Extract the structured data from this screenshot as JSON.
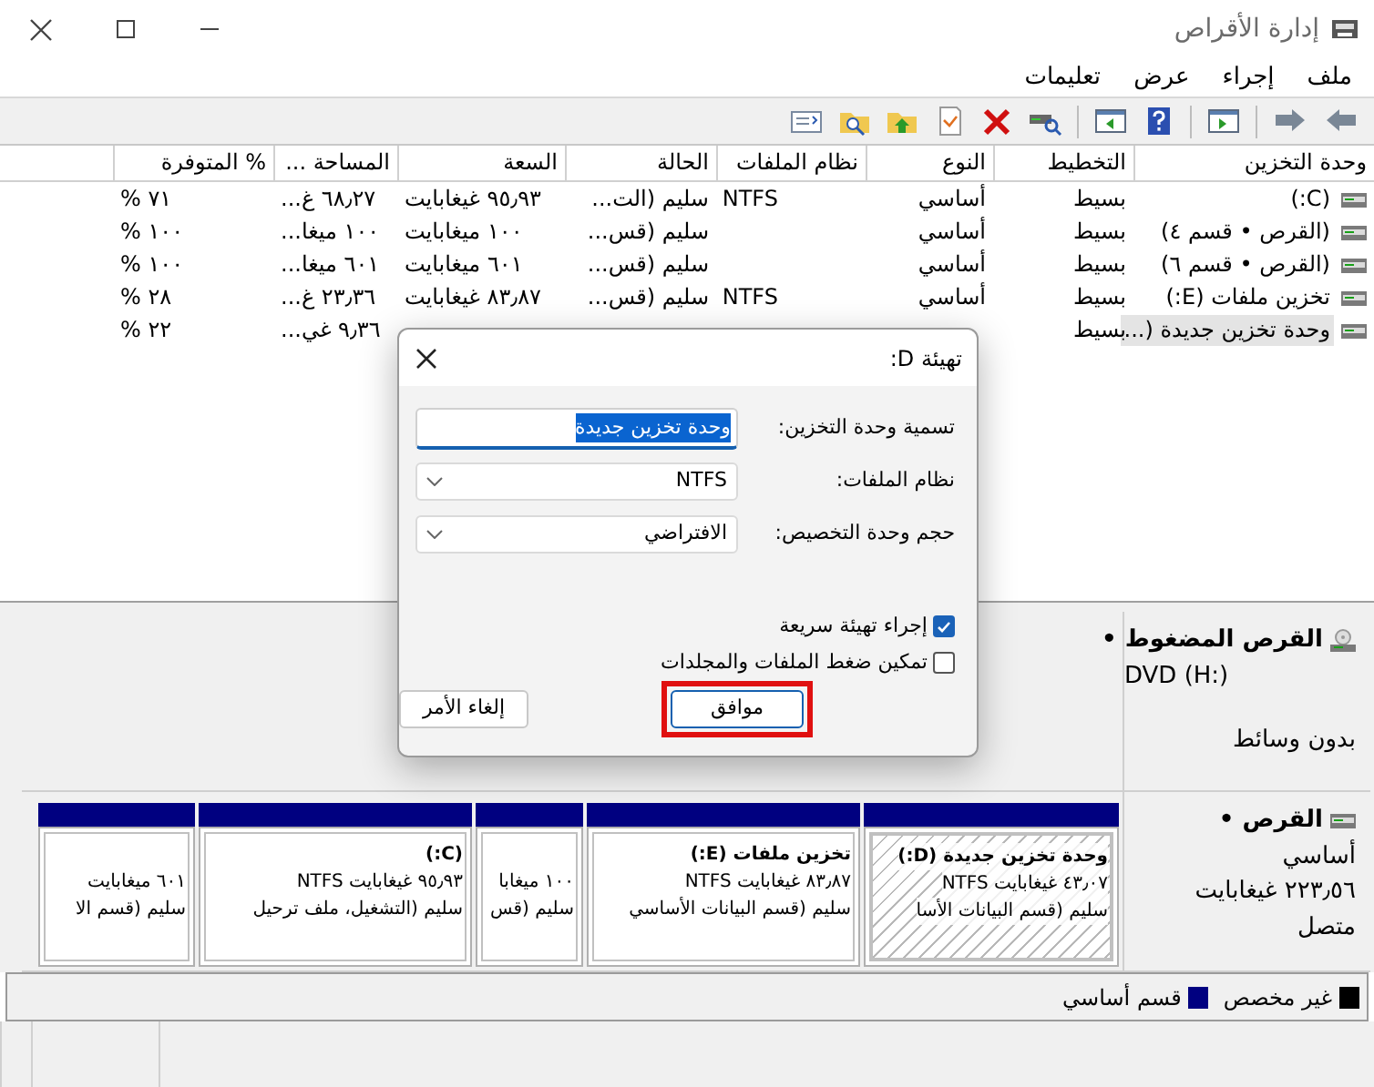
{
  "window": {
    "title": "إدارة الأقراص"
  },
  "menu": [
    "ملف",
    "إجراء",
    "عرض",
    "تعليمات"
  ],
  "volumes": {
    "columns": [
      "وحدة التخزين",
      "التخطيط",
      "النوع",
      "نظام الملفات",
      "الحالة",
      "السعة",
      "المساحة ...",
      "% المتوفرة"
    ],
    "rows": [
      {
        "cells": [
          "(C:)",
          "بسيط",
          "أساسي",
          "NTFS",
          "سليم (الت...",
          "٩٥٫٩٣ غيغابايت",
          "٦٨٫٢٧ غ...",
          "٧١ %"
        ],
        "selected": false
      },
      {
        "cells": [
          "(القرص • قسم ٤)",
          "بسيط",
          "أساسي",
          null,
          "سليم (قس...",
          "١٠٠ ميغابايت",
          "١٠٠ ميغا...",
          "١٠٠ %"
        ],
        "selected": false
      },
      {
        "cells": [
          "(القرص • قسم ٦)",
          "بسيط",
          "أساسي",
          null,
          "سليم (قس...",
          "٦٠١ ميغابايت",
          "٦٠١ ميغا...",
          "١٠٠ %"
        ],
        "selected": false
      },
      {
        "cells": [
          "تخزين ملفات (E:)",
          "بسيط",
          "أساسي",
          "NTFS",
          "سليم (قس...",
          "٨٣٫٨٧ غيغابايت",
          "٢٣٫٣٦ غ...",
          "٢٨ %"
        ],
        "selected": false
      },
      {
        "cells": [
          "وحدة تخزين جديدة (...",
          "بسيط",
          null,
          null,
          null,
          null,
          "٩٫٣٦ غي...",
          "٢٢ %"
        ],
        "selected": true
      }
    ]
  },
  "disks": [
    {
      "kind": "cdrom",
      "name": "القرص المضغوط •",
      "lines": [
        "DVD (H:)",
        "بدون وسائط"
      ]
    },
    {
      "kind": "disk",
      "name": "القرص •",
      "lines": [
        "أساسي",
        "٢٢٣٫٥٦ غيغابايت",
        "متصل"
      ],
      "partitions": [
        {
          "title": "وحدة تخزين جديدة (D:)",
          "size": "٤٣٫٠٧ غيغابايت NTFS",
          "status": "سليم (قسم البيانات الأسا",
          "selected": true
        },
        {
          "title": "تخزين ملفات (E:)",
          "size": "٨٣٫٨٧ غيغابايت NTFS",
          "status": "سليم (قسم البيانات الأساسي",
          "selected": false
        },
        {
          "size": "١٠٠ ميغابا",
          "status": "سليم (قس",
          "selected": false
        },
        {
          "title": "(C:)",
          "size": "٩٥٫٩٣ غيغابايت NTFS",
          "status": "سليم (التشغيل، ملف ترحيل",
          "selected": false
        },
        {
          "size": "٦٠١ ميغابايت",
          "status": "سليم (قسم الا",
          "selected": false
        }
      ]
    }
  ],
  "legend": [
    {
      "label": "غير مخصص",
      "color": "#000000"
    },
    {
      "label": "قسم أساسي",
      "color": "#000080"
    }
  ],
  "dialog": {
    "title": "تهيئة D:",
    "fields": [
      {
        "kind": "text",
        "label": "تسمية وحدة التخزين:",
        "value": "وحدة تخزين جديدة",
        "text_selected": true
      },
      {
        "kind": "select",
        "label": "نظام الملفات:",
        "value": "NTFS"
      },
      {
        "kind": "select",
        "label": "حجم وحدة التخصيص:",
        "value": "الافتراضي"
      }
    ],
    "checkboxes": [
      {
        "label": "إجراء تهيئة سريعة",
        "checked": true
      },
      {
        "label": "تمكين ضغط الملفات والمجلدات",
        "checked": false
      }
    ],
    "buttons": [
      {
        "kind": "primary",
        "label": "موافق",
        "highlighted": true
      },
      {
        "kind": "cancel",
        "label": "إلغاء الأمر",
        "highlighted": false
      }
    ]
  }
}
